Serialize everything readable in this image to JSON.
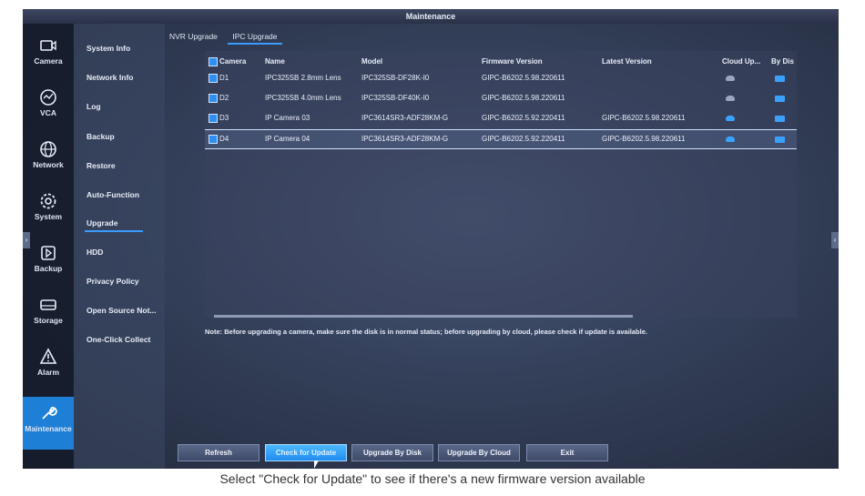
{
  "window": {
    "title": "Maintenance"
  },
  "left_nav": {
    "items": [
      {
        "label": "Camera",
        "icon": "camera-icon"
      },
      {
        "label": "VCA",
        "icon": "vca-icon"
      },
      {
        "label": "Network",
        "icon": "globe-icon"
      },
      {
        "label": "System",
        "icon": "gear-icon"
      },
      {
        "label": "Backup",
        "icon": "backup-icon"
      },
      {
        "label": "Storage",
        "icon": "storage-icon"
      },
      {
        "label": "Alarm",
        "icon": "alarm-icon"
      },
      {
        "label": "Maintenance",
        "icon": "wrench-icon",
        "active": true
      }
    ]
  },
  "sub_nav": {
    "items": [
      {
        "label": "System Info"
      },
      {
        "label": "Network Info"
      },
      {
        "label": "Log"
      },
      {
        "label": "Backup"
      },
      {
        "label": "Restore"
      },
      {
        "label": "Auto-Function"
      },
      {
        "label": "Upgrade",
        "active": true
      },
      {
        "label": "HDD"
      },
      {
        "label": "Privacy Policy"
      },
      {
        "label": "Open Source Not..."
      },
      {
        "label": "One-Click Collect"
      }
    ]
  },
  "tabs": [
    {
      "label": "NVR Upgrade"
    },
    {
      "label": "IPC Upgrade",
      "active": true
    }
  ],
  "table": {
    "columns": [
      "Camera",
      "Name",
      "Model",
      "Firmware Version",
      "Latest Version",
      "Cloud Up...",
      "By Dis"
    ],
    "rows": [
      {
        "camera": "D1",
        "name": "IPC325SB 2.8mm Lens",
        "model": "IPC325SB-DF28K-I0",
        "firmware": "GIPC-B6202.5.98.220611",
        "latest": "",
        "cloud": "unavailable",
        "selected": false
      },
      {
        "camera": "D2",
        "name": "IPC325SB 4.0mm Lens",
        "model": "IPC325SB-DF40K-I0",
        "firmware": "GIPC-B6202.5.98.220611",
        "latest": "",
        "cloud": "unavailable",
        "selected": false
      },
      {
        "camera": "D3",
        "name": "IP Camera 03",
        "model": "IPC3614SR3-ADF28KM-G",
        "firmware": "GIPC-B6202.5.92.220411",
        "latest": "GIPC-B6202.5.98.220611",
        "cloud": "available",
        "selected": false
      },
      {
        "camera": "D4",
        "name": "IP Camera 04",
        "model": "IPC3614SR3-ADF28KM-G",
        "firmware": "GIPC-B6202.5.92.220411",
        "latest": "GIPC-B6202.5.98.220611",
        "cloud": "available",
        "selected": true
      }
    ]
  },
  "note": "Note: Before upgrading a camera, make sure the disk is in normal status; before upgrading by cloud, please check if update is available.",
  "buttons": {
    "refresh": "Refresh",
    "check_update": "Check for Update",
    "upgrade_disk": "Upgrade By Disk",
    "upgrade_cloud": "Upgrade By Cloud",
    "exit": "Exit"
  },
  "caption": "Select \"Check for Update\" to see if there's a new firmware version available",
  "colors": {
    "accent": "#1e7fd6",
    "highlight": "#3a9bff",
    "background": "#2c3550"
  }
}
